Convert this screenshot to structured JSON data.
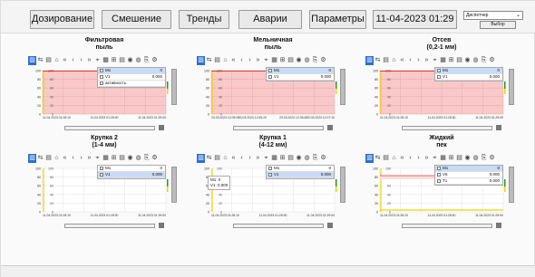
{
  "nav": {
    "buttons": [
      "Дозирование",
      "Смешение",
      "Тренды",
      "Аварии",
      "Параметры"
    ],
    "datetime": "11-04-2023 01:29",
    "user_select": "Диспетчер",
    "choose_button": "Выбор"
  },
  "toolbar_icons": [
    "bar-icon",
    "pan-icon",
    "zoom-box-icon",
    "home-icon",
    "fast-back-icon",
    "back-icon",
    "forward-icon",
    "fast-forward-icon",
    "cursor-icon",
    "grid-icon",
    "axes-icon",
    "table-icon",
    "play-icon",
    "stop-icon",
    "export-icon",
    "settings-icon"
  ],
  "panels": [
    {
      "title_line1": "Фильтровая",
      "title_line2": "пыль",
      "style": "red",
      "legend": [
        {
          "name": "M1",
          "value": "0",
          "selected": true
        },
        {
          "name": "V1",
          "value": "0.000",
          "selected": false
        },
        {
          "name": "активность",
          "value": "",
          "selected": false
        }
      ],
      "y_ticks_left": [
        "100",
        "80",
        "60",
        "40",
        "20",
        "0"
      ],
      "x_ticks": [
        "11.04.2023 01:28:10",
        "11.04.2023 01:28:30",
        "11.04.2023 01:29:00"
      ],
      "tooltip": ""
    },
    {
      "title_line1": "Мельничная",
      "title_line2": "пыль",
      "style": "red",
      "legend": [
        {
          "name": "M1",
          "value": "0",
          "selected": true
        },
        {
          "name": "V1",
          "value": "0.000",
          "selected": false
        }
      ],
      "y_ticks_left": [
        "100",
        "80",
        "60",
        "40",
        "20",
        "0"
      ],
      "x_ticks": [
        "23.03.2023 12:05:00",
        "23.03.2023 12:05:20",
        "23.03.2023 12:05:40",
        "23.03.2023 12:07:10"
      ],
      "tooltip": ""
    },
    {
      "title_line1": "Отсев",
      "title_line2": "(0,2-1 мм)",
      "style": "red",
      "legend": [
        {
          "name": "M1",
          "value": "0",
          "selected": true
        },
        {
          "name": "V1",
          "value": "0.000",
          "selected": false
        }
      ],
      "y_ticks_left": [
        "100",
        "80",
        "60",
        "40",
        "20",
        "0"
      ],
      "x_ticks": [
        "11.04.2023 01:28:10",
        "11.04.2023 01:28:30",
        "11.04.2023 01:29:00"
      ],
      "tooltip": ""
    },
    {
      "title_line1": "Крупка 2",
      "title_line2": "(1-4 мм)",
      "style": "plain",
      "legend": [
        {
          "name": "M1",
          "value": "0",
          "selected": false
        },
        {
          "name": "V1",
          "value": "0.000",
          "selected": true
        }
      ],
      "y_ticks_left": [
        "100",
        "80",
        "60",
        "40",
        "20",
        "0"
      ],
      "x_ticks": [
        "11.04.2023 01:28:10",
        "11.04.2023 01:28:30",
        "11.04.2023 01:29:00"
      ],
      "tooltip": ""
    },
    {
      "title_line1": "Крупка 1",
      "title_line2": "(4-12 мм)",
      "style": "plain",
      "legend": [
        {
          "name": "M1",
          "value": "0",
          "selected": false
        },
        {
          "name": "V1",
          "value": "0.000",
          "selected": true
        }
      ],
      "y_ticks_left": [
        "100",
        "80",
        "60",
        "40",
        "20",
        "0"
      ],
      "x_ticks": [
        "11.04.2023 01:28:10",
        "11.04.2023 01:28:30",
        "11.04.2023 01:29:00"
      ],
      "tooltip": "M1: 0\nV1: 0.000"
    },
    {
      "title_line1": "Жидкий",
      "title_line2": "пек",
      "style": "yellow",
      "legend": [
        {
          "name": "M1",
          "value": "0",
          "selected": true
        },
        {
          "name": "V6",
          "value": "0.000",
          "selected": false
        },
        {
          "name": "T1",
          "value": "0.000",
          "selected": false
        }
      ],
      "y_ticks_left": [
        "100",
        "80",
        "60",
        "40",
        "20",
        "0"
      ],
      "x_ticks": [
        "11.04.2023 01:28:10",
        "11.04.2023 01:28:30",
        "11.04.2023 01:29:00"
      ],
      "tooltip": ""
    }
  ],
  "colors": {
    "red_fill": "#f9c9c9",
    "red_line": "#e23a3a",
    "yellow_line": "#f2d400",
    "blue_accent": "#2b6fd6",
    "green_line": "#1e9c2a"
  }
}
